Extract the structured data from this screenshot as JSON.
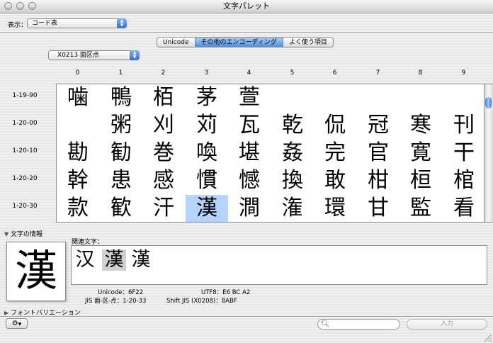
{
  "window": {
    "title": "文字パレット"
  },
  "view": {
    "label": "表示：",
    "selected": "コード表"
  },
  "tabs": [
    {
      "label": "Unicode",
      "active": false
    },
    {
      "label": "その他のエンコーディング",
      "active": true
    },
    {
      "label": "よく使う項目",
      "active": false
    }
  ],
  "encoding": {
    "selected": "X0213 面区点"
  },
  "columns": [
    "0",
    "1",
    "2",
    "3",
    "4",
    "5",
    "6",
    "7",
    "8",
    "9"
  ],
  "rows": [
    {
      "label": "1-19-90",
      "chars": [
        "噛",
        "鴨",
        "栢",
        "茅",
        "萱",
        "",
        "",
        "",
        "",
        ""
      ]
    },
    {
      "label": "1-20-00",
      "chars": [
        "",
        "粥",
        "刈",
        "苅",
        "瓦",
        "乾",
        "侃",
        "冠",
        "寒",
        "刊"
      ]
    },
    {
      "label": "1-20-10",
      "chars": [
        "勘",
        "勧",
        "巻",
        "喚",
        "堪",
        "姦",
        "完",
        "官",
        "寛",
        "干"
      ]
    },
    {
      "label": "1-20-20",
      "chars": [
        "幹",
        "患",
        "感",
        "慣",
        "憾",
        "換",
        "敢",
        "柑",
        "桓",
        "棺"
      ]
    },
    {
      "label": "1-20-30",
      "chars": [
        "款",
        "歓",
        "汗",
        "漢",
        "澗",
        "潅",
        "環",
        "甘",
        "監",
        "看"
      ]
    }
  ],
  "selected_cell": {
    "row": 4,
    "col": 3
  },
  "char_info": {
    "header": "文字の情報",
    "glyph": "漢",
    "related_label": "関連文字：",
    "related": [
      "汉",
      "漢",
      "漢"
    ],
    "related_selected": 1,
    "unicode_label": "Unicode：",
    "unicode_value": "6F22",
    "utf8_label": "UTF8：",
    "utf8_value": "E6 BC A2",
    "jis_label": "JIS 面-区-点：",
    "jis_value": "1-20-33",
    "shiftjis_label": "Shift JIS (X0208)：",
    "shiftjis_value": "8ABF"
  },
  "font_variation": {
    "label": "フォントバリエーション"
  },
  "bottom": {
    "gear_icon": "gear-icon",
    "search_placeholder": "",
    "insert_label": "入力"
  }
}
